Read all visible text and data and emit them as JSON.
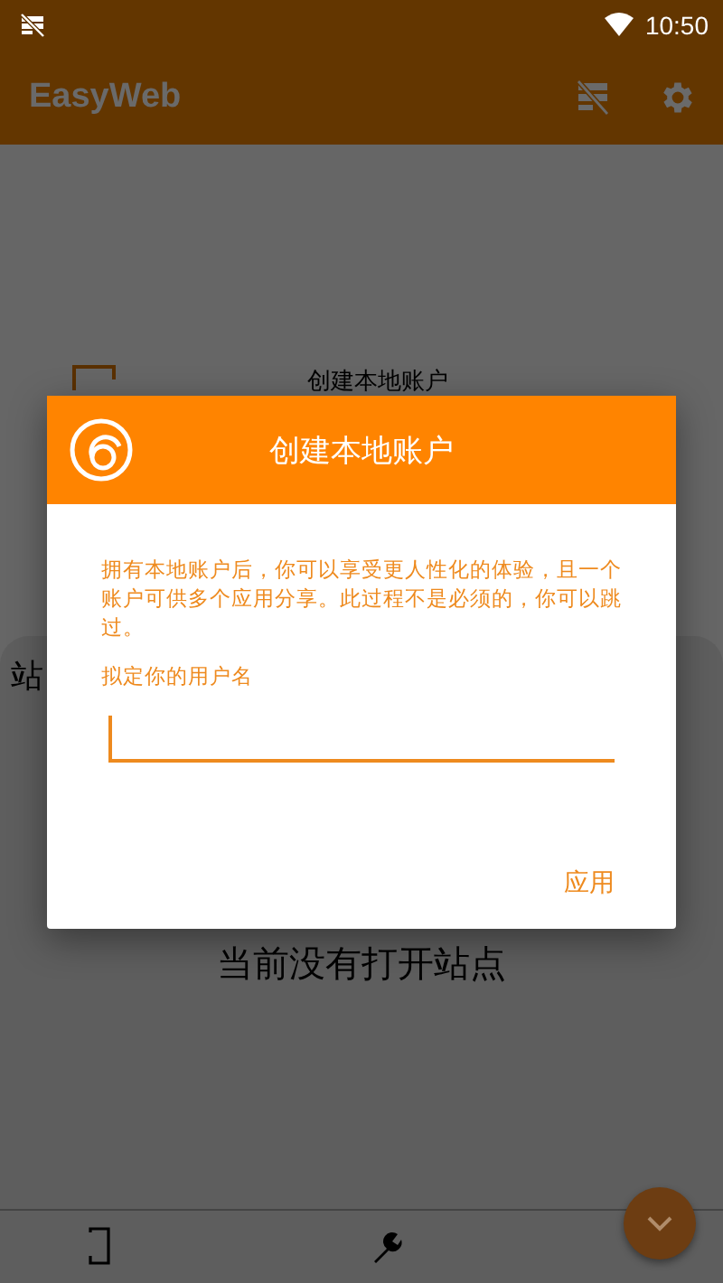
{
  "status_bar": {
    "time": "10:50"
  },
  "app_bar": {
    "title": "EasyWeb"
  },
  "background_item": {
    "label": "创建本地账户"
  },
  "sheet": {
    "label": "站",
    "empty_message": "当前没有打开站点"
  },
  "dialog": {
    "title": "创建本地账户",
    "message": "拥有本地账户后，你可以享受更人性化的体验，且一个账户可供多个应用分享。此过程不是必须的，你可以跳过。",
    "field_label": "拟定你的用户名",
    "button": "应用"
  }
}
